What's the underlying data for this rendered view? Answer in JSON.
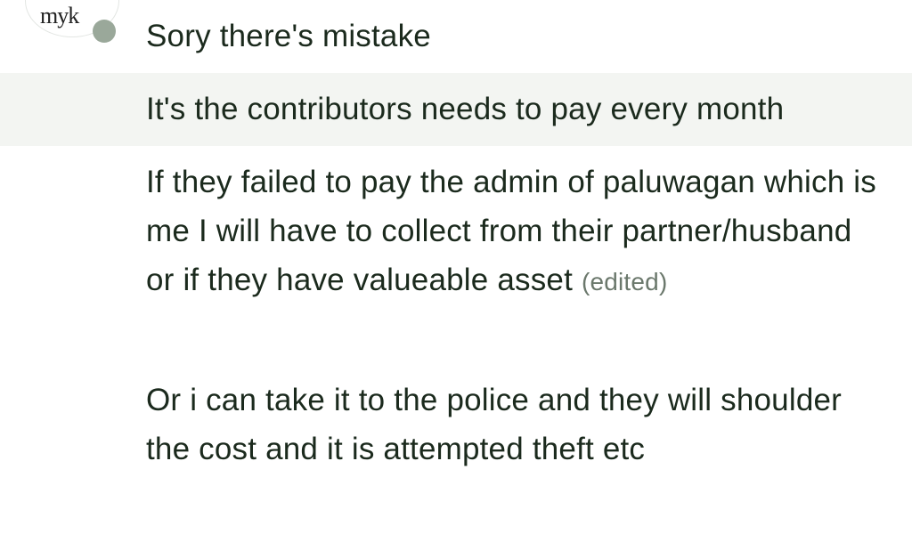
{
  "sender": {
    "avatar_text": "myk"
  },
  "messages": [
    {
      "text": "Sory there's mistake"
    },
    {
      "text": "It's the contributors needs to pay every month"
    },
    {
      "text": "If they failed to pay the admin of paluwagan which is me I will have to collect from their partner/husband or if they have valueable asset",
      "edited_label": "(edited)"
    },
    {
      "text": "Or i can take it to the police and they will shoulder the cost and it is attempted theft etc"
    }
  ],
  "colors": {
    "text": "#1b2a1d",
    "hover_row": "#f3f5f2",
    "presence_dot": "#9aa89a",
    "edited": "#6b786c"
  }
}
